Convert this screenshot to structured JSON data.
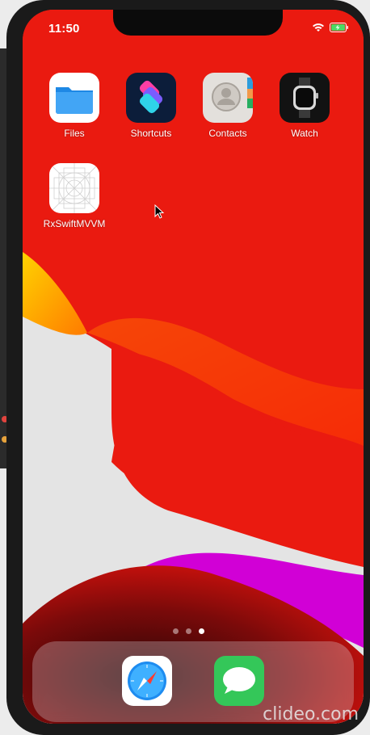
{
  "status_bar": {
    "time": "11:50"
  },
  "home_apps": [
    {
      "label": "Files",
      "icon": "files-icon"
    },
    {
      "label": "Shortcuts",
      "icon": "shortcuts-icon"
    },
    {
      "label": "Contacts",
      "icon": "contacts-icon"
    },
    {
      "label": "Watch",
      "icon": "watch-icon"
    },
    {
      "label": "RxSwiftMVVM",
      "icon": "blank-app-icon"
    }
  ],
  "page_indicator": {
    "pages": 3,
    "current": 3
  },
  "dock_apps": [
    {
      "label": "Safari",
      "icon": "safari-icon"
    },
    {
      "label": "Messages",
      "icon": "messages-icon"
    }
  ],
  "watermark": "clideo.com",
  "colors": {
    "wallpaper_red": "#ea1a10",
    "wallpaper_magenta": "#d100d6",
    "battery_green": "#4cd964"
  }
}
